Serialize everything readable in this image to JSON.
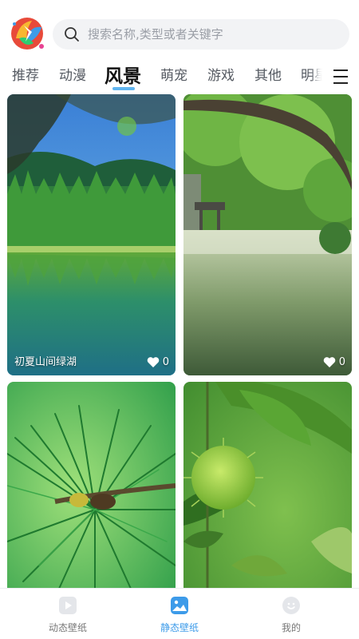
{
  "search": {
    "placeholder": "搜索名称,类型或者关键字"
  },
  "tabs": [
    {
      "label": "推荐",
      "active": false
    },
    {
      "label": "动漫",
      "active": false
    },
    {
      "label": "风景",
      "active": true
    },
    {
      "label": "萌宠",
      "active": false
    },
    {
      "label": "游戏",
      "active": false
    },
    {
      "label": "其他",
      "active": false
    },
    {
      "label": "明星",
      "active": false
    }
  ],
  "colors": {
    "accent": "#3d9be9",
    "indicator": "#60b5f0",
    "search_bg": "#f2f3f5"
  },
  "wallpapers": [
    {
      "title": "初夏山间绿湖",
      "likes": "0"
    },
    {
      "title": "",
      "likes": "0"
    },
    {
      "title": "",
      "likes": ""
    },
    {
      "title": "",
      "likes": ""
    }
  ],
  "bottom_nav": [
    {
      "label": "动态壁纸",
      "icon": "play-icon",
      "active": false
    },
    {
      "label": "静态壁纸",
      "icon": "image-icon",
      "active": true
    },
    {
      "label": "我的",
      "icon": "profile-icon",
      "active": false
    }
  ]
}
